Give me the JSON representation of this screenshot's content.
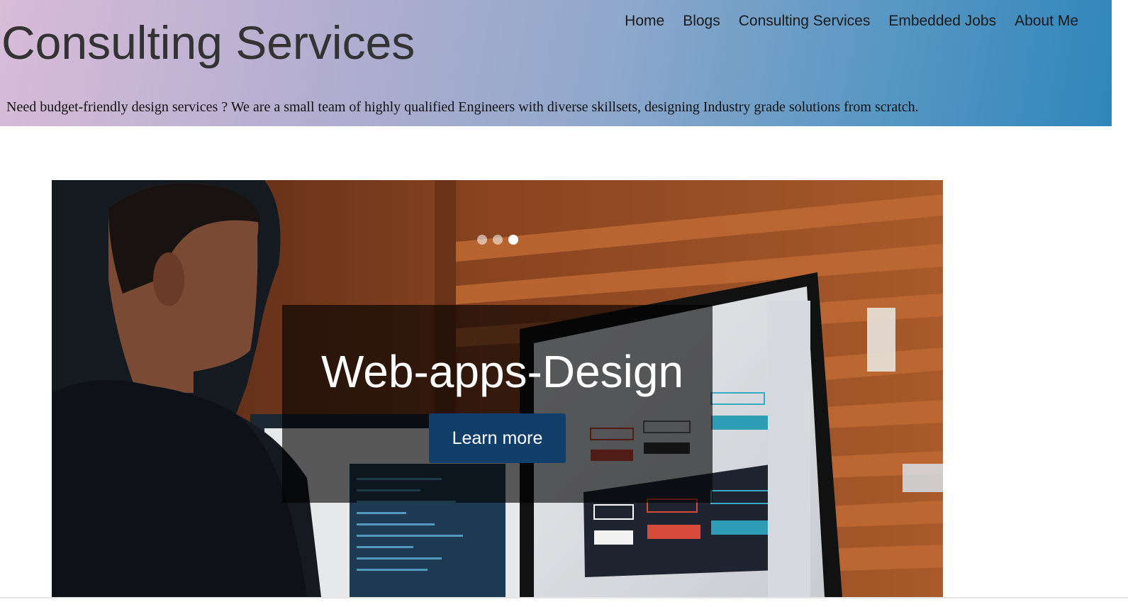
{
  "header": {
    "title": "Consulting Services",
    "tagline": "Need budget-friendly design services ? We are a small team of highly qualified Engineers with diverse skillsets, designing Industry grade solutions from scratch.",
    "gradient": [
      "#d8bcd8",
      "#2f86bb"
    ]
  },
  "nav": {
    "items": [
      {
        "label": "Home"
      },
      {
        "label": "Blogs"
      },
      {
        "label": "Consulting Services"
      },
      {
        "label": "Embedded Jobs"
      },
      {
        "label": "About Me"
      }
    ]
  },
  "carousel": {
    "slide_count": 3,
    "active_index": 2,
    "caption": {
      "title": "Web-apps-Design",
      "button_label": "Learn more"
    },
    "button_color": "#123e6a",
    "image_description_icon": "photo-of-designer-at-computer"
  }
}
